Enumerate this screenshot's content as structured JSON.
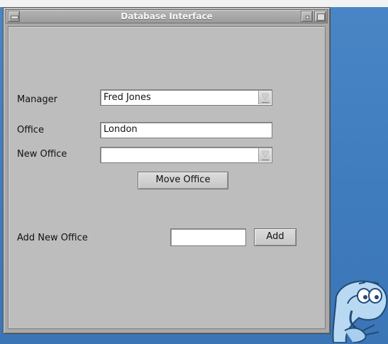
{
  "window": {
    "title": "Database Interface"
  },
  "form": {
    "manager": {
      "label": "Manager",
      "selected": "Fred Jones"
    },
    "office": {
      "label": "Office",
      "value": "London"
    },
    "new_office": {
      "label": "New Office",
      "selected": ""
    },
    "move_button": "Move Office",
    "add_new_office": {
      "label": "Add New Office",
      "value": "",
      "button": "Add"
    }
  },
  "icons": {
    "window_menu": "window-menu-icon",
    "minimize": "minimize-icon",
    "maximize": "maximize-icon",
    "dropdown": "chevron-down-icon",
    "mascot": "desktop-mascot-icon"
  },
  "colors": {
    "desktop": "#3f7dbf",
    "window_bg": "#bdbdbd",
    "titlebar": "#a8a8a8"
  }
}
